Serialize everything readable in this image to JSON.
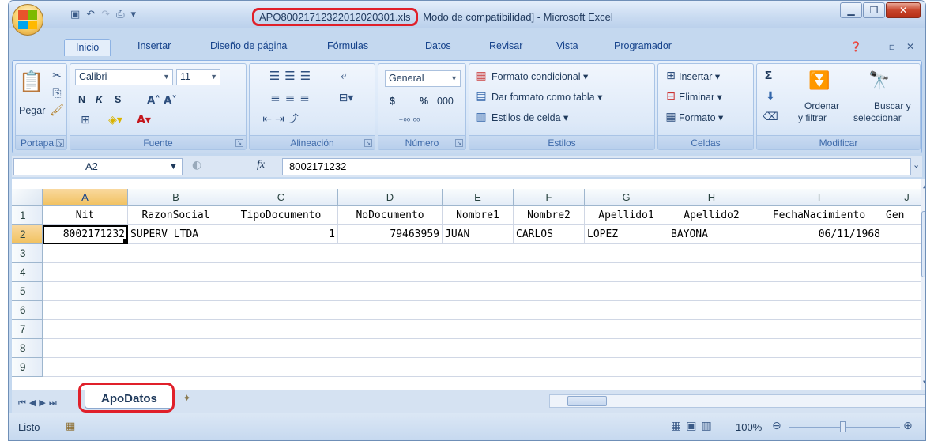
{
  "window": {
    "filename": "APO8002171232201202030​1.xls",
    "title_rest": "Modo de compatibilidad] - Microsoft Excel"
  },
  "tabs": [
    "Inicio",
    "Insertar",
    "Diseño de página",
    "Fórmulas",
    "Datos",
    "Revisar",
    "Vista",
    "Programador"
  ],
  "ribbon": {
    "clipboard": {
      "paste": "Pegar",
      "label": "Portapa..."
    },
    "font": {
      "name": "Calibri",
      "size": "11",
      "bold": "N",
      "italic": "K",
      "underline": "S",
      "label": "Fuente"
    },
    "alignment": {
      "label": "Alineación"
    },
    "number": {
      "format": "General",
      "currency": "$",
      "percent": "%",
      "thousands": "000",
      "label": "Número"
    },
    "styles": {
      "conditional": "Formato condicional",
      "table": "Dar formato como tabla",
      "cell": "Estilos de celda",
      "label": "Estilos"
    },
    "cells": {
      "insert": "Insertar",
      "delete": "Eliminar",
      "format": "Formato",
      "label": "Celdas"
    },
    "editing": {
      "sum": "Σ",
      "sort_1": "Ordenar",
      "sort_2": "y filtrar",
      "find_1": "Buscar y",
      "find_2": "seleccionar",
      "label": "Modificar"
    }
  },
  "formula_bar": {
    "name_box": "A2",
    "fx": "fx",
    "value": "8002171232"
  },
  "grid": {
    "columns": [
      "A",
      "B",
      "C",
      "D",
      "E",
      "F",
      "G",
      "H",
      "I",
      "J"
    ],
    "row_numbers": [
      "1",
      "2",
      "3",
      "4",
      "5",
      "6",
      "7",
      "8",
      "9"
    ],
    "header_row": [
      "Nit",
      "RazonSocial",
      "TipoDocumento",
      "NoDocumento",
      "Nombre1",
      "Nombre2",
      "Apellido1",
      "Apellido2",
      "FechaNacimiento",
      "Gen"
    ],
    "data_row": [
      "8002171232",
      "SUPERV LTDA",
      "1",
      "79463959",
      "JUAN",
      "CARLOS",
      "LOPEZ",
      "BAYONA",
      "06/11/1968",
      ""
    ]
  },
  "sheet_tab": "ApoDatos",
  "status": {
    "text": "Listo",
    "zoom": "100%"
  },
  "colors": {
    "accent_red": "#e0202a",
    "ribbon_blue": "#c4d8ef"
  }
}
